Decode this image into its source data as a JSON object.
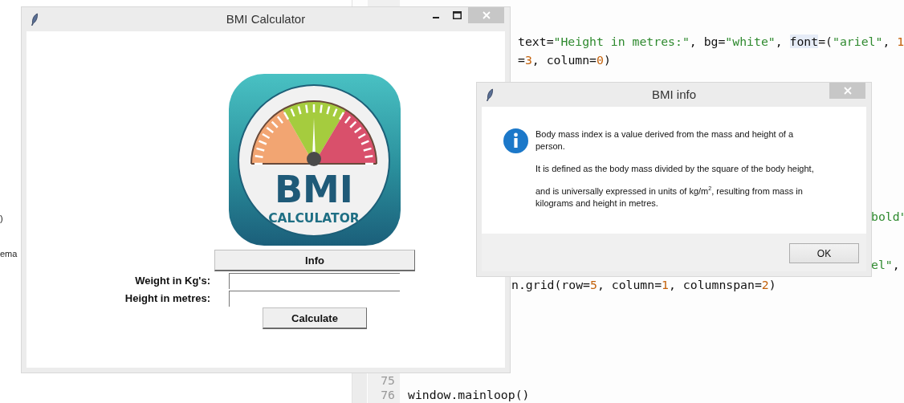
{
  "editor": {
    "side_texts": [
      ")",
      "ema"
    ],
    "lines": [
      {
        "tokens": [
          {
            "text": "text=",
            "kind": "plain"
          },
          {
            "text": "\"Height in metres:\"",
            "kind": "str"
          },
          {
            "text": ", bg=",
            "kind": "plain"
          },
          {
            "text": "\"white\"",
            "kind": "str"
          },
          {
            "text": ", ",
            "kind": "plain"
          },
          {
            "text": "font",
            "kind": "mark"
          },
          {
            "text": "=(",
            "kind": "plain"
          },
          {
            "text": "\"ariel\"",
            "kind": "str"
          },
          {
            "text": ", ",
            "kind": "plain"
          },
          {
            "text": "1",
            "kind": "num"
          }
        ]
      },
      {
        "tokens": [
          {
            "text": "=",
            "kind": "plain"
          },
          {
            "text": "3",
            "kind": "num"
          },
          {
            "text": ", column=",
            "kind": "plain"
          },
          {
            "text": "0",
            "kind": "num"
          },
          {
            "text": ")",
            "kind": "plain"
          }
        ]
      },
      {
        "tokens": [
          {
            "text": "bold\"",
            "kind": "str"
          }
        ]
      },
      {
        "tokens": [
          {
            "text": "el\"",
            "kind": "str"
          },
          {
            "text": ",",
            "kind": "plain"
          }
        ]
      },
      {
        "tokens": [
          {
            "text": "n.grid(row=",
            "kind": "plain"
          },
          {
            "text": "5",
            "kind": "num"
          },
          {
            "text": ", column=",
            "kind": "plain"
          },
          {
            "text": "1",
            "kind": "num"
          },
          {
            "text": ", columnspan=",
            "kind": "plain"
          },
          {
            "text": "2",
            "kind": "num"
          },
          {
            "text": ")",
            "kind": "plain"
          }
        ]
      },
      {
        "number": "75"
      },
      {
        "number": "76",
        "tokens": [
          {
            "text": "window.mainloop()",
            "kind": "plain"
          }
        ]
      }
    ]
  },
  "main_window": {
    "title": "BMI Calculator",
    "logo": {
      "title": "BMI",
      "subtitle": "CALCULATOR"
    },
    "info_button": "Info",
    "fields": [
      {
        "label": "Weight in Kg's:"
      },
      {
        "label": "Height in metres:"
      }
    ],
    "calculate_button": "Calculate"
  },
  "dialog": {
    "title": "BMI info",
    "paragraphs": [
      "Body mass index is a value derived from the mass and height of a person.",
      "It is defined as the body mass divided by the square of the body height,",
      "and is universally expressed in units of kg/m$^{2}$, resulting from mass in kilograms and height in metres."
    ],
    "ok_button": "OK"
  }
}
